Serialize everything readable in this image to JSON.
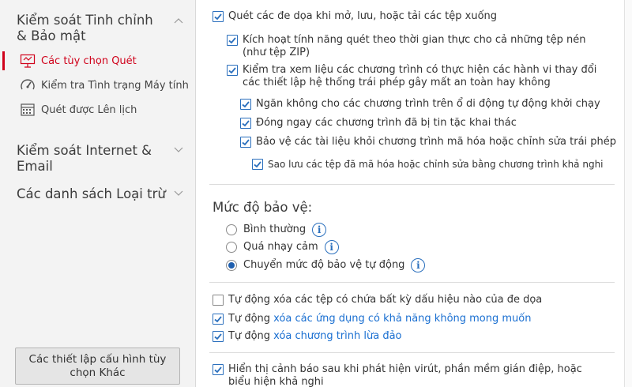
{
  "sidebar": {
    "sections": [
      {
        "title": "Kiểm soát Tinh chỉnh & Bảo mật",
        "expanded": true
      },
      {
        "title": "Kiểm soát Internet & Email",
        "expanded": false
      },
      {
        "title": "Các danh sách Loại trừ",
        "expanded": false
      }
    ],
    "items": [
      {
        "label": "Các tùy chọn Quét",
        "icon": "monitor-scan-icon",
        "active": true
      },
      {
        "label": "Kiểm tra Tình trạng Máy tính",
        "icon": "gauge-icon",
        "active": false
      },
      {
        "label": "Quét được Lên lịch",
        "icon": "calendar-icon",
        "active": false
      }
    ],
    "more_button": "Các thiết lập cấu hình tùy chọn Khác"
  },
  "options": {
    "scan_on_open": {
      "label": "Quét các đe dọa khi mở, lưu, hoặc tải các tệp xuống",
      "checked": true
    },
    "realtime_zip": {
      "label": "Kích hoạt tính năng quét theo thời gian thực cho cả những tệp nén (như tệp ZIP)",
      "checked": true
    },
    "check_behavior": {
      "label": "Kiểm tra xem liệu các chương trình có thực hiện các hành vi thay đổi các thiết lập hệ thống trái phép gây mất an toàn hay không",
      "checked": true
    },
    "block_autorun": {
      "label": "Ngăn không cho các chương trình trên ổ di động tự động khởi chạy",
      "checked": true
    },
    "close_exploited": {
      "label": "Đóng ngay các chương trình đã bị tin tặc khai thác",
      "checked": true
    },
    "protect_docs": {
      "label": "Bảo vệ các tài liệu khỏi chương trình mã hóa hoặc chỉnh sửa trái phép",
      "checked": true
    },
    "backup_encrypted": {
      "label": "Sao lưu các tệp đã mã hóa hoặc chỉnh sửa bằng chương trình khả nghi",
      "checked": true
    }
  },
  "protection_level": {
    "title": "Mức độ bảo vệ:",
    "choices": [
      {
        "label": "Bình thường",
        "selected": false
      },
      {
        "label": "Quá nhạy cảm",
        "selected": false
      },
      {
        "label": "Chuyển mức độ bảo vệ tự động",
        "selected": true
      }
    ],
    "info_glyph": "i"
  },
  "auto_delete": {
    "threats": {
      "label": "Tự động xóa các tệp có chứa bất kỳ dấu hiệu nào của đe dọa",
      "checked": false
    },
    "pua": {
      "prefix": "Tự động ",
      "link": "xóa các ứng dụng có khả năng không mong muốn",
      "checked": true
    },
    "scam": {
      "prefix": "Tự động ",
      "link": "xóa chương trình lừa đảo",
      "checked": true
    }
  },
  "warning": {
    "label": "Hiển thị cảnh báo sau khi phát hiện virút, phần mềm gián điệp, hoặc biểu hiện khả nghi",
    "checked": true
  },
  "colors": {
    "accent_red": "#d0021b",
    "checkbox_blue": "#2a6fbd",
    "link_blue": "#1a6fd1"
  }
}
